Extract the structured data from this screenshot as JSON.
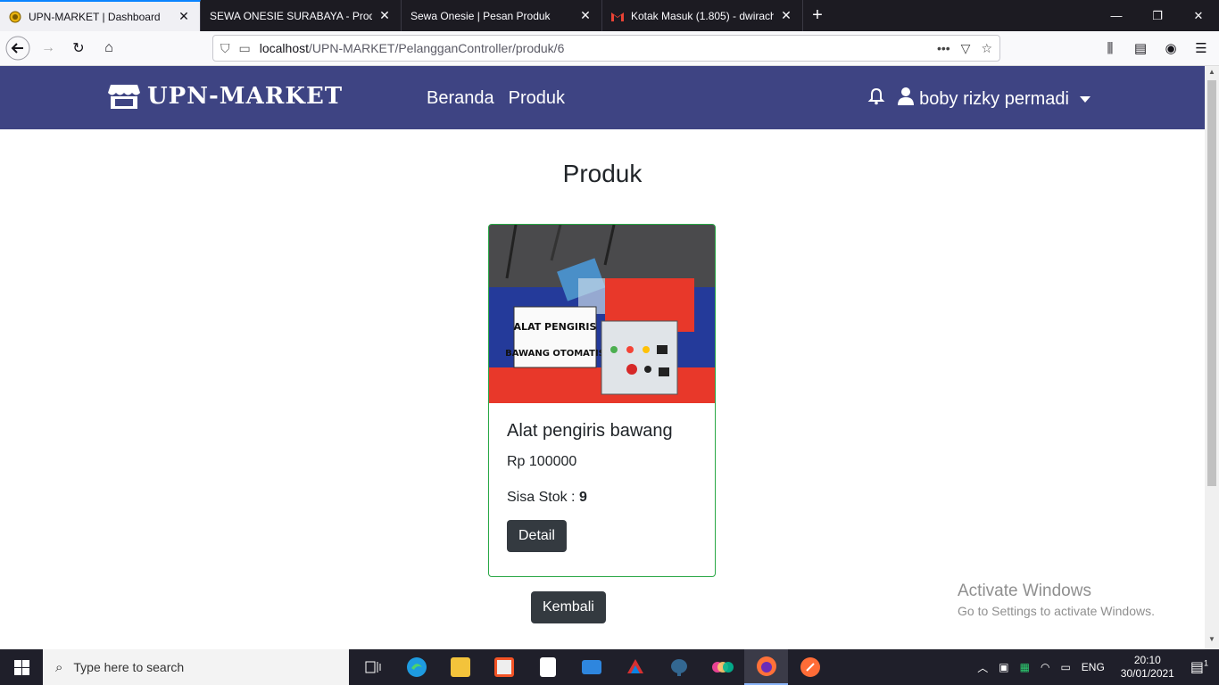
{
  "browser": {
    "tabs": [
      {
        "title": "UPN-MARKET | Dashboard",
        "active": true
      },
      {
        "title": "SEWA ONESIE SURABAYA - Produk",
        "active": false
      },
      {
        "title": "Sewa Onesie | Pesan Produk",
        "active": false
      },
      {
        "title": "Kotak Masuk (1.805) - dwirach",
        "active": false
      }
    ],
    "url_host": "localhost",
    "url_path": "/UPN-MARKET/PelangganController/produk/6"
  },
  "site": {
    "brand": "UPN-MARKET",
    "nav": {
      "home": "Beranda",
      "products": "Produk"
    },
    "user_name": "boby rizky permadi",
    "page_title": "Produk",
    "product": {
      "name": "Alat pengiris bawang",
      "price": "Rp 100000",
      "stock_label": "Sisa Stok :",
      "stock_value": "9",
      "detail_label": "Detail",
      "image_sign_line1": "ALAT PENGIRIS",
      "image_sign_line2": "BAWANG OTOMATIS"
    },
    "back_label": "Kembali",
    "colors": {
      "navbar": "#3e4483",
      "button": "#343a40",
      "card_border": "#28a745"
    }
  },
  "watermark": {
    "line1": "Activate Windows",
    "line2": "Go to Settings to activate Windows."
  },
  "taskbar": {
    "search_placeholder": "Type here to search",
    "lang": "ENG",
    "time": "20:10",
    "date": "30/01/2021",
    "notif_count": "1"
  }
}
